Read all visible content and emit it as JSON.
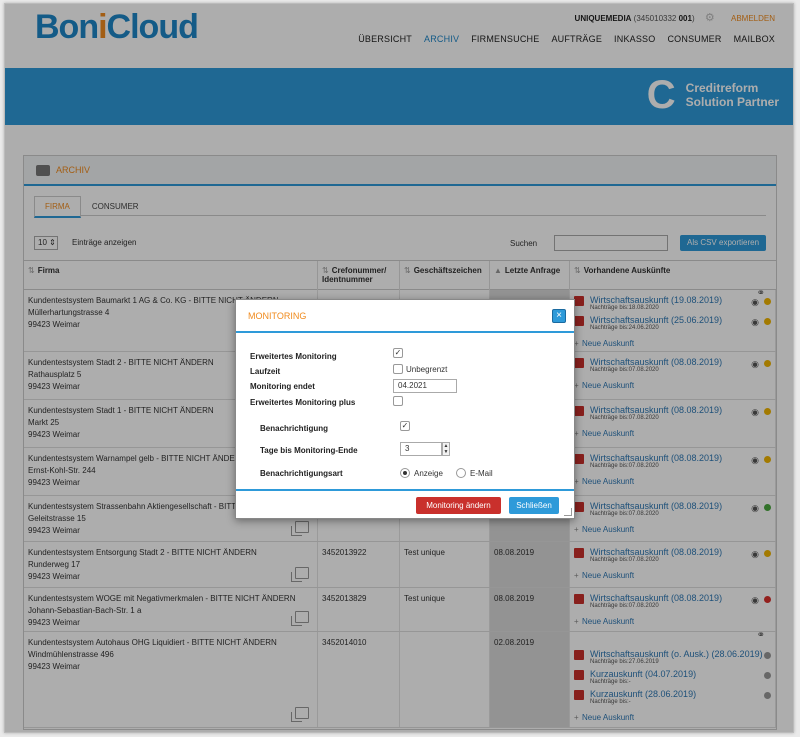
{
  "header": {
    "logo": {
      "part1": "Bon",
      "part2": "i",
      "part3": "Cloud"
    },
    "user": {
      "name": "UNIQUEMEDIA",
      "id_prefix": "(345010332 ",
      "id_num": "001",
      "id_suffix": ")",
      "logout": "ABMELDEN"
    },
    "nav": [
      "ÜBERSICHT",
      "ARCHIV",
      "FIRMENSUCHE",
      "AUFTRÄGE",
      "INKASSO",
      "CONSUMER",
      "MAILBOX"
    ],
    "nav_active": "ARCHIV"
  },
  "banner": {
    "logo_letter": "C",
    "line1": "Creditreform",
    "line2": "Solution Partner"
  },
  "panel": {
    "title": "ARCHIV",
    "tabs": [
      "FIRMA",
      "CONSUMER"
    ],
    "entries_value": "10",
    "entries_label": "Einträge anzeigen",
    "search_label": "Suchen",
    "csv_button": "Als CSV exportieren",
    "columns": [
      "Firma",
      "Crefonummer/ Identnummer",
      "Geschäftszeichen",
      "Letzte Anfrage",
      "Vorhandene Auskünfte"
    ]
  },
  "rows": [
    {
      "name": "Kundentestsystem Baumarkt 1 AG & Co. KG - BITTE NICHT ÄNDERN",
      "street": "Müllerhartungstrasse 4",
      "city": "99423 Weimar",
      "crefo": "",
      "ref": "",
      "date": "",
      "reports": [
        {
          "title": "Wirtschaftsauskunft (19.08.2019)",
          "sub": "Nachträge bis:18.08.2020",
          "dot": "yellow"
        },
        {
          "title": "Wirtschaftsauskunft (25.06.2019)",
          "sub": "Nachträge bis:24.06.2020",
          "dot": "yellow"
        }
      ]
    },
    {
      "name": "Kundentestsystem Stadt 2 - BITTE NICHT ÄNDERN",
      "street": "Rathausplatz 5",
      "city": "99423 Weimar",
      "crefo": "",
      "ref": "",
      "date": "",
      "reports": [
        {
          "title": "Wirtschaftsauskunft (08.08.2019)",
          "sub": "Nachträge bis:07.08.2020",
          "dot": "yellow"
        }
      ]
    },
    {
      "name": "Kundentestsystem Stadt 1 - BITTE NICHT ÄNDERN",
      "street": "Markt 25",
      "city": "99423 Weimar",
      "crefo": "",
      "ref": "",
      "date": "",
      "reports": [
        {
          "title": "Wirtschaftsauskunft (08.08.2019)",
          "sub": "Nachträge bis:07.08.2020",
          "dot": "yellow"
        }
      ]
    },
    {
      "name": "Kundentestsystem Warnampel gelb - BITTE NICHT ÄNDERN",
      "street": "Ernst-Kohl-Str. 244",
      "city": "99423 Weimar",
      "crefo": "",
      "ref": "",
      "date": "",
      "reports": [
        {
          "title": "Wirtschaftsauskunft (08.08.2019)",
          "sub": "Nachträge bis:07.08.2020",
          "dot": "yellow"
        }
      ]
    },
    {
      "name": "Kundentestsystem Strassenbahn Aktiengesellschaft - BITTE NICHT ÄNDERN",
      "street": "Geleitstrasse 15",
      "city": "99423 Weimar",
      "crefo": "",
      "ref": "",
      "date": "",
      "reports": [
        {
          "title": "Wirtschaftsauskunft (08.08.2019)",
          "sub": "Nachträge bis:07.08.2020",
          "dot": "green"
        }
      ]
    },
    {
      "name": "Kundentestsystem Entsorgung Stadt 2 - BITTE NICHT ÄNDERN",
      "street": "Runderweg 17",
      "city": "99423 Weimar",
      "crefo": "3452013922",
      "ref": "Test unique",
      "date": "08.08.2019",
      "reports": [
        {
          "title": "Wirtschaftsauskunft (08.08.2019)",
          "sub": "Nachträge bis:07.08.2020",
          "dot": "yellow"
        }
      ]
    },
    {
      "name": "Kundentestsystem WOGE mit Negativmerkmalen - BITTE NICHT ÄNDERN",
      "street": "Johann-Sebastian-Bach-Str. 1 a",
      "city": "99423 Weimar",
      "crefo": "3452013829",
      "ref": "Test unique",
      "date": "08.08.2019",
      "reports": [
        {
          "title": "Wirtschaftsauskunft (08.08.2019)",
          "sub": "Nachträge bis:07.08.2020",
          "dot": "red"
        }
      ]
    },
    {
      "name": "Kundentestsystem Autohaus OHG Liquidiert - BITTE NICHT ÄNDERN",
      "street": "Windmühlenstrasse 496",
      "city": "99423 Weimar",
      "crefo": "3452014010",
      "ref": "",
      "date": "02.08.2019",
      "reports": [
        {
          "title": "Wirtschaftsauskunft (o. Ausk.) (28.06.2019)",
          "sub": "Nachträge bis:27.06.2019",
          "dot": "gray"
        },
        {
          "title": "Kurzauskunft (04.07.2019)",
          "sub": "Nachträge bis:-",
          "dot": "gray"
        },
        {
          "title": "Kurzauskunft (28.06.2019)",
          "sub": "Nachträge bis:-",
          "dot": "gray"
        }
      ]
    }
  ],
  "new_report_label": "Neue Auskunft",
  "modal": {
    "title": "MONITORING",
    "close_glyph": "×",
    "extended_label": "Erweitertes Monitoring",
    "extended_checked": true,
    "duration_label": "Laufzeit",
    "unlimited_label": "Unbegrenzt",
    "unlimited_checked": false,
    "end_label": "Monitoring endet",
    "end_value": "04.2021",
    "plus_label": "Erweitertes Monitoring plus",
    "plus_checked": false,
    "notify_label": "Benachrichtigung",
    "notify_checked": true,
    "days_label": "Tage bis Monitoring-Ende",
    "days_value": "3",
    "type_label": "Benachrichtigungsart",
    "option_display": "Anzeige",
    "option_email": "E-Mail",
    "selected_option": "Anzeige",
    "change_button": "Monitoring ändern",
    "close_button": "Schließen"
  },
  "colors": {
    "brand_blue": "#2e9ad9",
    "brand_orange": "#f08b1e",
    "danger": "#c9302c"
  }
}
